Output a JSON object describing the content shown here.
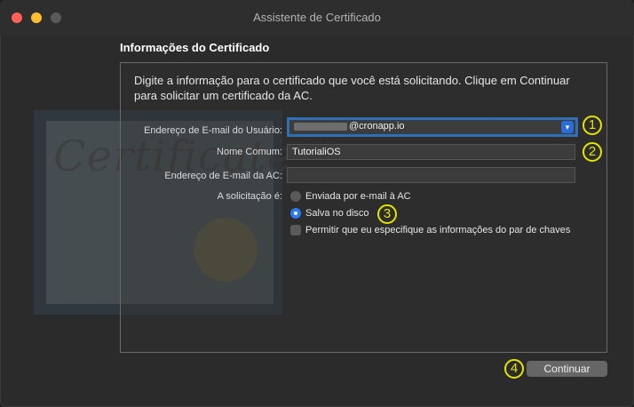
{
  "window": {
    "title": "Assistente de Certificado"
  },
  "section_title": "Informações do Certificado",
  "intro_text": "Digite a informação para o certificado que você está solicitando. Clique em Continuar para solicitar um certificado da AC.",
  "form": {
    "email_label": "Endereço de E-mail do Usuário:",
    "email_value": "@cronapp.io",
    "name_label": "Nome Comum:",
    "name_value": "TutorialiOS",
    "ca_email_label": "Endereço de E-mail da AC:",
    "ca_email_value": "",
    "request_label": "A solicitação é:",
    "option_email": "Enviada por e-mail à AC",
    "option_disk": "Salva no disco",
    "option_keypair": "Permitir que eu especifique as informações do par de chaves"
  },
  "background_art": {
    "script_text": "Certificate"
  },
  "markers": [
    "1",
    "2",
    "3",
    "4"
  ],
  "buttons": {
    "continue_label": "Continuar"
  },
  "colors": {
    "accent": "#2a7bf2",
    "marker": "#e4e400",
    "focus_ring": "#2f6fb5"
  }
}
